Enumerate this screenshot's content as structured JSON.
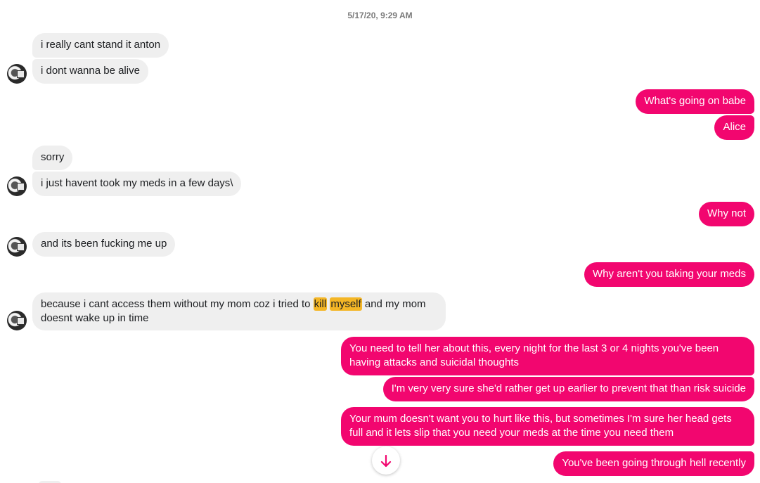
{
  "timestamp": "5/17/20, 9:29 AM",
  "messages": {
    "m1": "i really cant stand it anton",
    "m2": "i dont wanna be alive",
    "m3": "What's going on babe",
    "m4": "Alice",
    "m5": "sorry",
    "m6": "i just havent took my meds in a few days\\",
    "m7": "Why not",
    "m8": "and its been fucking me up",
    "m9": "Why aren't you taking your meds",
    "m10a": "because i cant access them without my mom coz i tried to",
    "m10b": "kill",
    "m10c": "myself",
    "m10d": "and my mom doesnt wake up in time",
    "m11": "You need to tell her about this, every night for the last 3 or 4 nights you've been having attacks and suicidal thoughts",
    "m12": "I'm very very sure she'd rather get up earlier to prevent that than risk suicide",
    "m13": "Your mum doesn't want you to hurt like this, but sometimes I'm sure her head gets full and it lets slip that you need your meds at the time you need them",
    "m14": "You've been going through hell recently"
  },
  "icons": {
    "avatar": "profile-photo",
    "scroll_down": "arrow-down-icon"
  },
  "colors": {
    "outgoing": "#f2066f",
    "incoming": "#efefef",
    "highlight": "#f4b626"
  }
}
